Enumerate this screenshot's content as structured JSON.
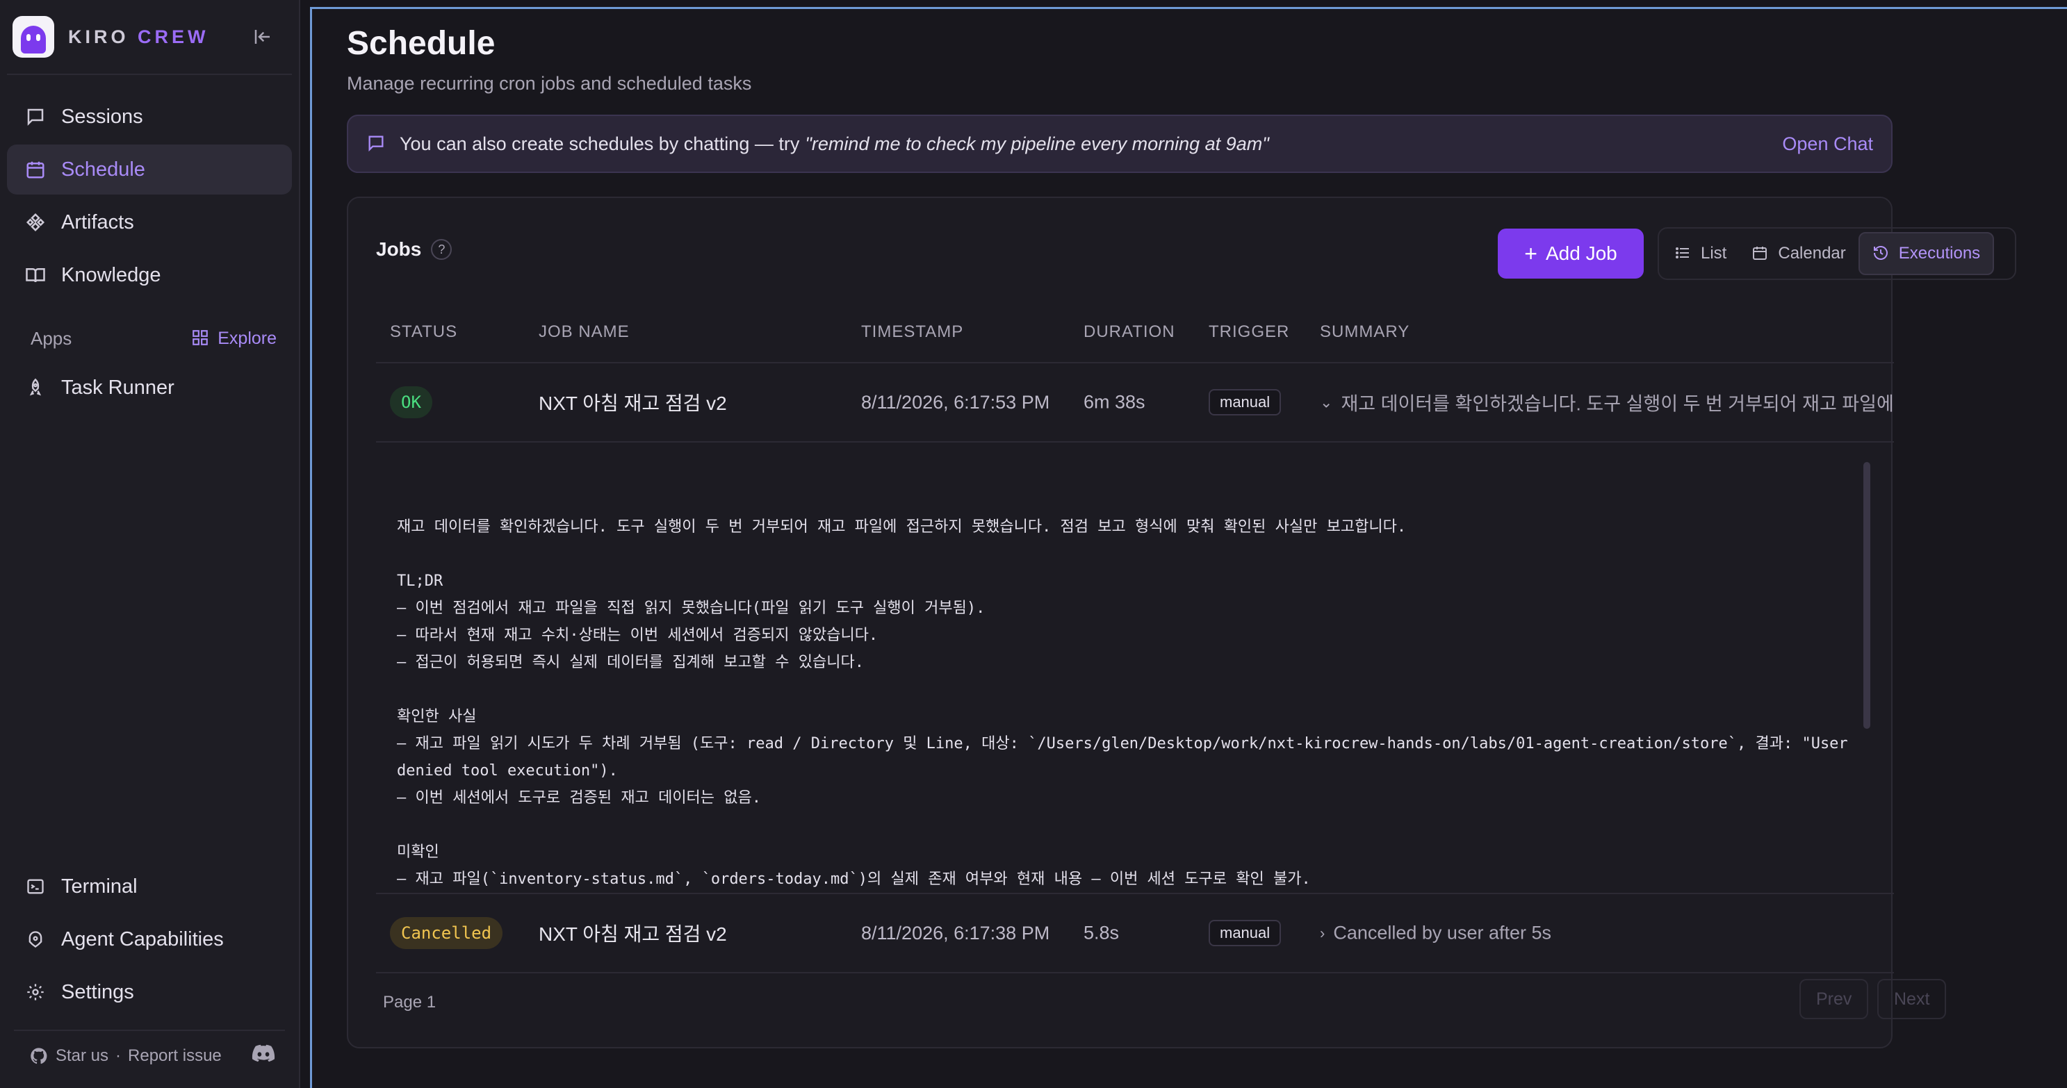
{
  "brand": {
    "name_1": "KIRO",
    "name_2": "CREW"
  },
  "sidebar": {
    "nav": [
      {
        "label": "Sessions",
        "icon": "chat-icon"
      },
      {
        "label": "Schedule",
        "icon": "calendar-icon"
      },
      {
        "label": "Artifacts",
        "icon": "artifacts-icon"
      },
      {
        "label": "Knowledge",
        "icon": "book-icon"
      }
    ],
    "apps_label": "Apps",
    "explore_label": "Explore",
    "apps": [
      {
        "label": "Task Runner",
        "icon": "rocket-icon"
      }
    ],
    "bottom": [
      {
        "label": "Terminal",
        "icon": "terminal-icon"
      },
      {
        "label": "Agent Capabilities",
        "icon": "capabilities-icon"
      },
      {
        "label": "Settings",
        "icon": "gear-icon"
      }
    ],
    "footer": {
      "star": "Star us",
      "sep": "·",
      "report": "Report issue"
    }
  },
  "page": {
    "title": "Schedule",
    "subtitle": "Manage recurring cron jobs and scheduled tasks",
    "hint_text": "You can also create schedules by chatting — try",
    "hint_quote": "\"remind me to check my pipeline every morning at 9am\"",
    "open_chat": "Open Chat"
  },
  "jobs": {
    "title": "Jobs",
    "help": "?",
    "add_label": "Add Job",
    "views": [
      {
        "label": "List",
        "icon": "list-icon"
      },
      {
        "label": "Calendar",
        "icon": "calendar-icon"
      },
      {
        "label": "Executions",
        "icon": "history-icon"
      }
    ],
    "columns": [
      "STATUS",
      "JOB NAME",
      "TIMESTAMP",
      "DURATION",
      "TRIGGER",
      "SUMMARY"
    ],
    "rows": [
      {
        "status": "OK",
        "name": "NXT 아침 재고 점검 v2",
        "timestamp": "8/11/2026, 6:17:53 PM",
        "duration": "6m 38s",
        "trigger": "manual",
        "summary": "재고 데이터를 확인하겠습니다. 도구 실행이 두 번 거부되어 재고 파일에 접근하지 못했습니다. 점검 보고 형식에 맞춰 확인된 사실만 보고합니다.",
        "details": "재고 데이터를 확인하겠습니다. 도구 실행이 두 번 거부되어 재고 파일에 접근하지 못했습니다. 점검 보고 형식에 맞춰 확인된 사실만 보고합니다.\n\nTL;DR\n— 이번 점검에서 재고 파일을 직접 읽지 못했습니다(파일 읽기 도구 실행이 거부됨).\n— 따라서 현재 재고 수치·상태는 이번 세션에서 검증되지 않았습니다.\n— 접근이 허용되면 즉시 실제 데이터를 집계해 보고할 수 있습니다.\n\n확인한 사실\n— 재고 파일 읽기 시도가 두 차례 거부됨 (도구: read / Directory 및 Line, 대상: `/Users/glen/Desktop/work/nxt-kirocrew-hands-on/labs/01-agent-creation/store`, 결과: \"User denied tool execution\").\n— 이번 세션에서 도구로 검증된 재고 데이터는 없음.\n\n미확인\n— 재고 파일(`inventory-status.md`, `orders-today.md`)의 실제 존재 여부와 현재 내용 — 이번 세션 도구로 확인 불가.\n— 저재고 품목, 품목별 수량, 오늘 주문 현황 — 원본을 읽지 못해 미확인."
      },
      {
        "status": "Cancelled",
        "name": "NXT 아침 재고 점검 v2",
        "timestamp": "8/11/2026, 6:17:38 PM",
        "duration": "5.8s",
        "trigger": "manual",
        "summary": "Cancelled by user after 5s"
      }
    ],
    "page_label": "Page 1",
    "prev": "Prev",
    "next": "Next"
  },
  "colors": {
    "accent": "#7c3aed",
    "ok": "#4ade80",
    "cancelled": "#f1c550",
    "focus_border": "#6f9ad6"
  }
}
